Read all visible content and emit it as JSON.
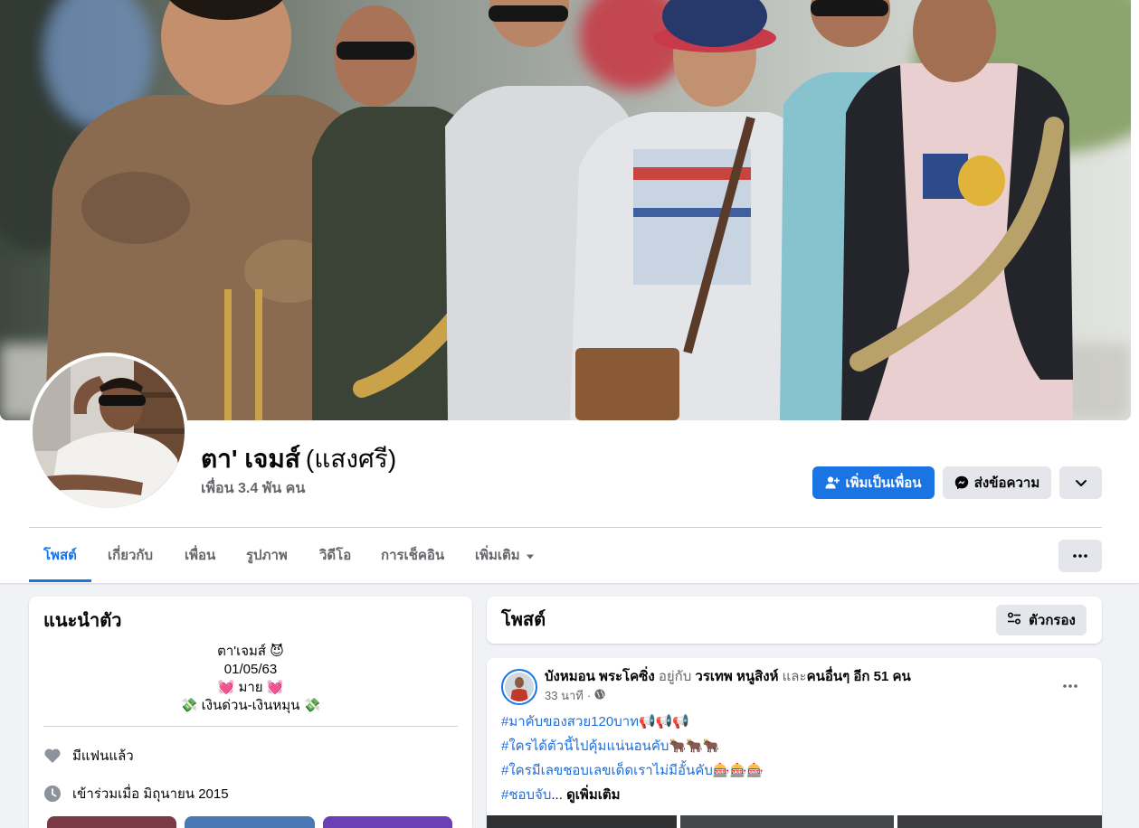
{
  "profile": {
    "name": "ตา' เจมส์",
    "alternate_name": "(แสงศรี)",
    "friends": "เพื่อน 3.4 พัน คน"
  },
  "actions": {
    "add_friend": {
      "label": "เพิ่มเป็นเพื่อน",
      "icon": "person-add-icon"
    },
    "message": {
      "label": "ส่งข้อความ",
      "icon": "messenger-icon"
    },
    "more": {
      "icon": "chevron-down-icon"
    }
  },
  "tabs": [
    {
      "label": "โพสต์",
      "active": true
    },
    {
      "label": "เกี่ยวกับ",
      "active": false
    },
    {
      "label": "เพื่อน",
      "active": false
    },
    {
      "label": "รูปภาพ",
      "active": false
    },
    {
      "label": "วิดีโอ",
      "active": false
    },
    {
      "label": "การเช็คอิน",
      "active": false
    },
    {
      "label": "เพิ่มเติม",
      "active": false,
      "icon": "caret-down-icon"
    }
  ],
  "tab_overflow": {
    "icon": "more-horizontal-icon"
  },
  "intro": {
    "title": "แนะนำตัว",
    "bio": [
      "ตา'เจมส์ 😈",
      "01/05/63",
      "💓 มาย 💓",
      "💸 เงินด่วน-เงินหมุน 💸"
    ],
    "details": [
      {
        "icon": "heart-icon",
        "text": "มีแฟนแล้ว"
      },
      {
        "icon": "clock-icon",
        "text": "เข้าร่วมเมื่อ มิถุนายน 2015"
      }
    ]
  },
  "posts": {
    "title": "โพสต์",
    "filter": {
      "label": "ตัวกรอง",
      "icon": "filter-icon"
    }
  },
  "post": {
    "author": "บังหมอน พระโคซิ่ง",
    "with": "อยู่กับ",
    "tagged": "วรเทพ หนูสิงห์",
    "and": "และ",
    "others": "คนอื่นๆ อีก 51 คน",
    "time": "33 นาที",
    "separator": "·",
    "privacy_icon": "globe-icon",
    "lines": [
      "#มาคับของสวย120บาท📢📢📢",
      "#ใครได้ตัวนี้ไปคุ้มแน่นอนคับ🐂🐂🐂",
      "#ใครมีเลขชอบเลขเด็ดเราไม่มีอั้นคับ🎰🎰🎰"
    ],
    "truncated_line": "#ชอบจับ",
    "ellipsis": "...",
    "see_more": "ดูเพิ่มเติม"
  },
  "colors": {
    "accent": "#1b74e4",
    "page_background": "#f0f2f5",
    "card_background": "#ffffff",
    "secondary_button": "#e4e6eb",
    "primary_text": "#050505",
    "secondary_text": "#65676b",
    "hashtag": "#216fdb"
  }
}
